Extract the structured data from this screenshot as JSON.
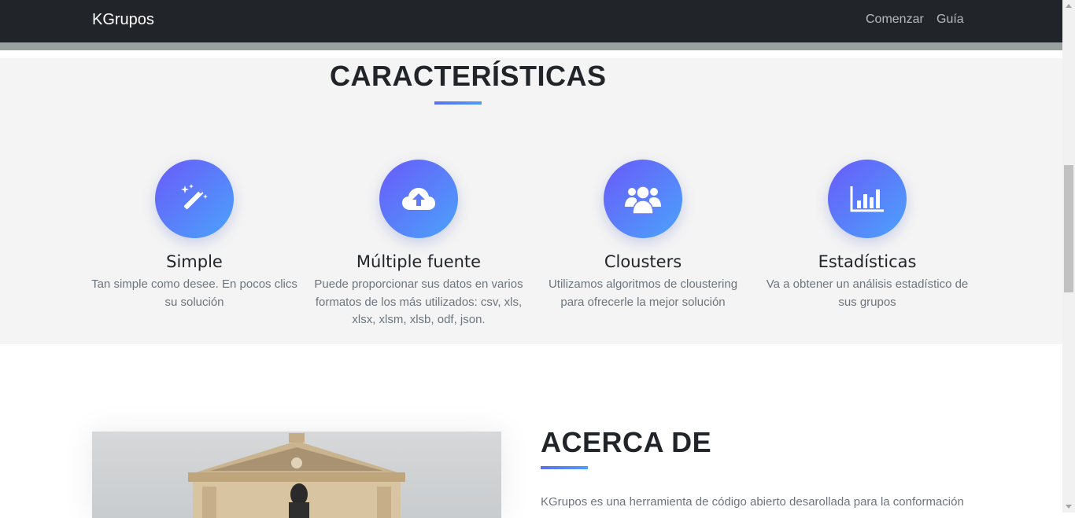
{
  "navbar": {
    "brand": "KGrupos",
    "links": [
      "Comenzar",
      "Guía"
    ]
  },
  "features": {
    "title": "CARACTERÍSTICAS",
    "items": [
      {
        "icon": "magic-wand-icon",
        "title": "Simple",
        "text": "Tan simple como desee. En pocos clics su solución"
      },
      {
        "icon": "cloud-upload-icon",
        "title": "Múltiple fuente",
        "text": "Puede proporcionar sus datos en varios formatos de los más utilizados: csv, xls, xlsx, xlsm, xlsb, odf, json."
      },
      {
        "icon": "users-icon",
        "title": "Clousters",
        "text": "Utilizamos algoritmos de cloustering para ofrecerle la mejor solución"
      },
      {
        "icon": "bar-chart-icon",
        "title": "Estadísticas",
        "text": "Va a obtener un análisis estadístico de sus grupos"
      }
    ]
  },
  "about": {
    "title": "ACERCA DE",
    "text": "KGrupos es una herramienta de código abierto desarollada para la conformación"
  },
  "colors": {
    "navbar": "#212529",
    "accent_start": "#6a5af9",
    "accent_end": "#4aa3fc",
    "section_bg": "#f4f4f4"
  }
}
